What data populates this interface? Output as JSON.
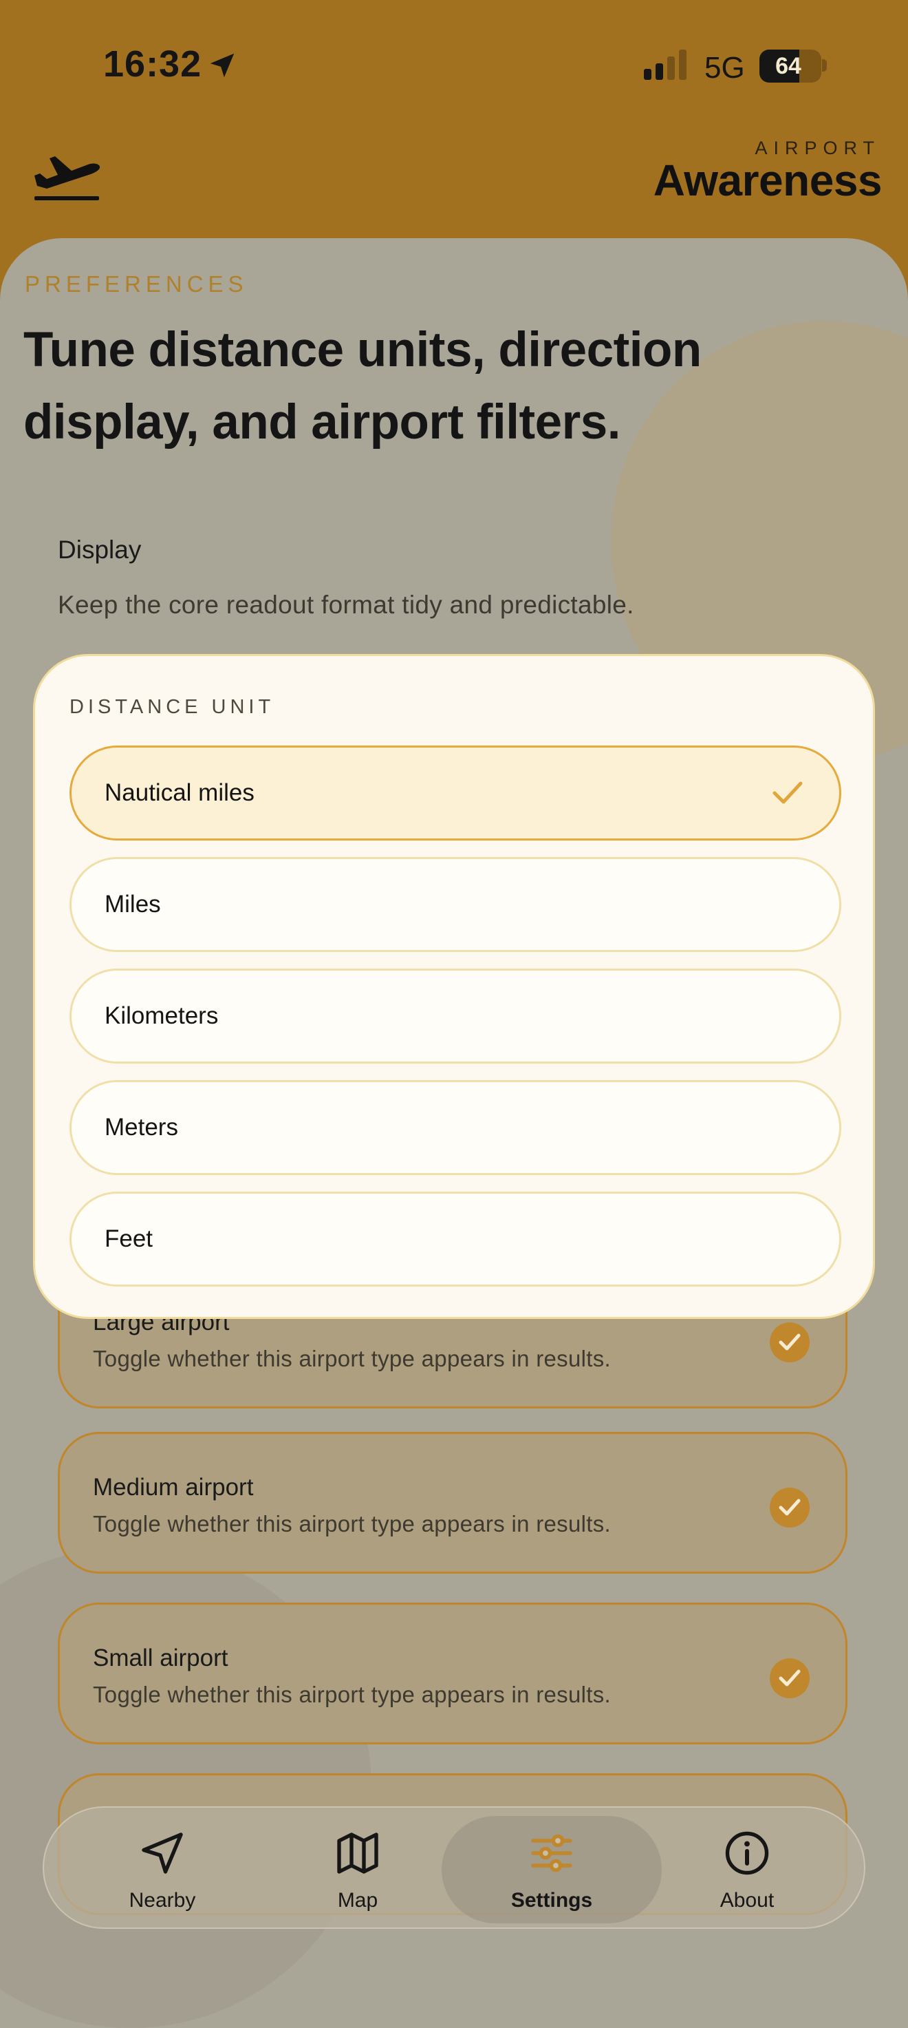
{
  "status_bar": {
    "time": "16:32",
    "network": "5G",
    "battery": "64",
    "battery_level": 0.64
  },
  "header": {
    "brand_kicker": "AIRPORT",
    "brand_title": "Awareness",
    "logo_icon": "departing-plane-icon"
  },
  "page": {
    "kicker": "PREFERENCES",
    "headline": "Tune distance units, direction display, and airport filters.",
    "section_title": "Display",
    "section_description": "Keep the core readout format tidy and predictable."
  },
  "airport_filters": [
    {
      "title": "Large airport",
      "description": "Toggle whether this airport type appears in results.",
      "checked": true
    },
    {
      "title": "Medium airport",
      "description": "Toggle whether this airport type appears in results.",
      "checked": true
    },
    {
      "title": "Small airport",
      "description": "Toggle whether this airport type appears in results.",
      "checked": true
    }
  ],
  "distance_modal": {
    "label": "DISTANCE UNIT",
    "options": [
      "Nautical miles",
      "Miles",
      "Kilometers",
      "Meters",
      "Feet"
    ],
    "selected": "Nautical miles"
  },
  "tabs": [
    {
      "label": "Nearby",
      "icon": "navigation-arrow-icon"
    },
    {
      "label": "Map",
      "icon": "map-icon"
    },
    {
      "label": "Settings",
      "icon": "sliders-icon",
      "active": true
    },
    {
      "label": "About",
      "icon": "info-icon"
    }
  ],
  "colors": {
    "accent": "#c0872c",
    "header": "#a2711f",
    "sheet": "#a9a597",
    "modal": "#fdf9f0",
    "selected_option": "#fcf1d4"
  }
}
